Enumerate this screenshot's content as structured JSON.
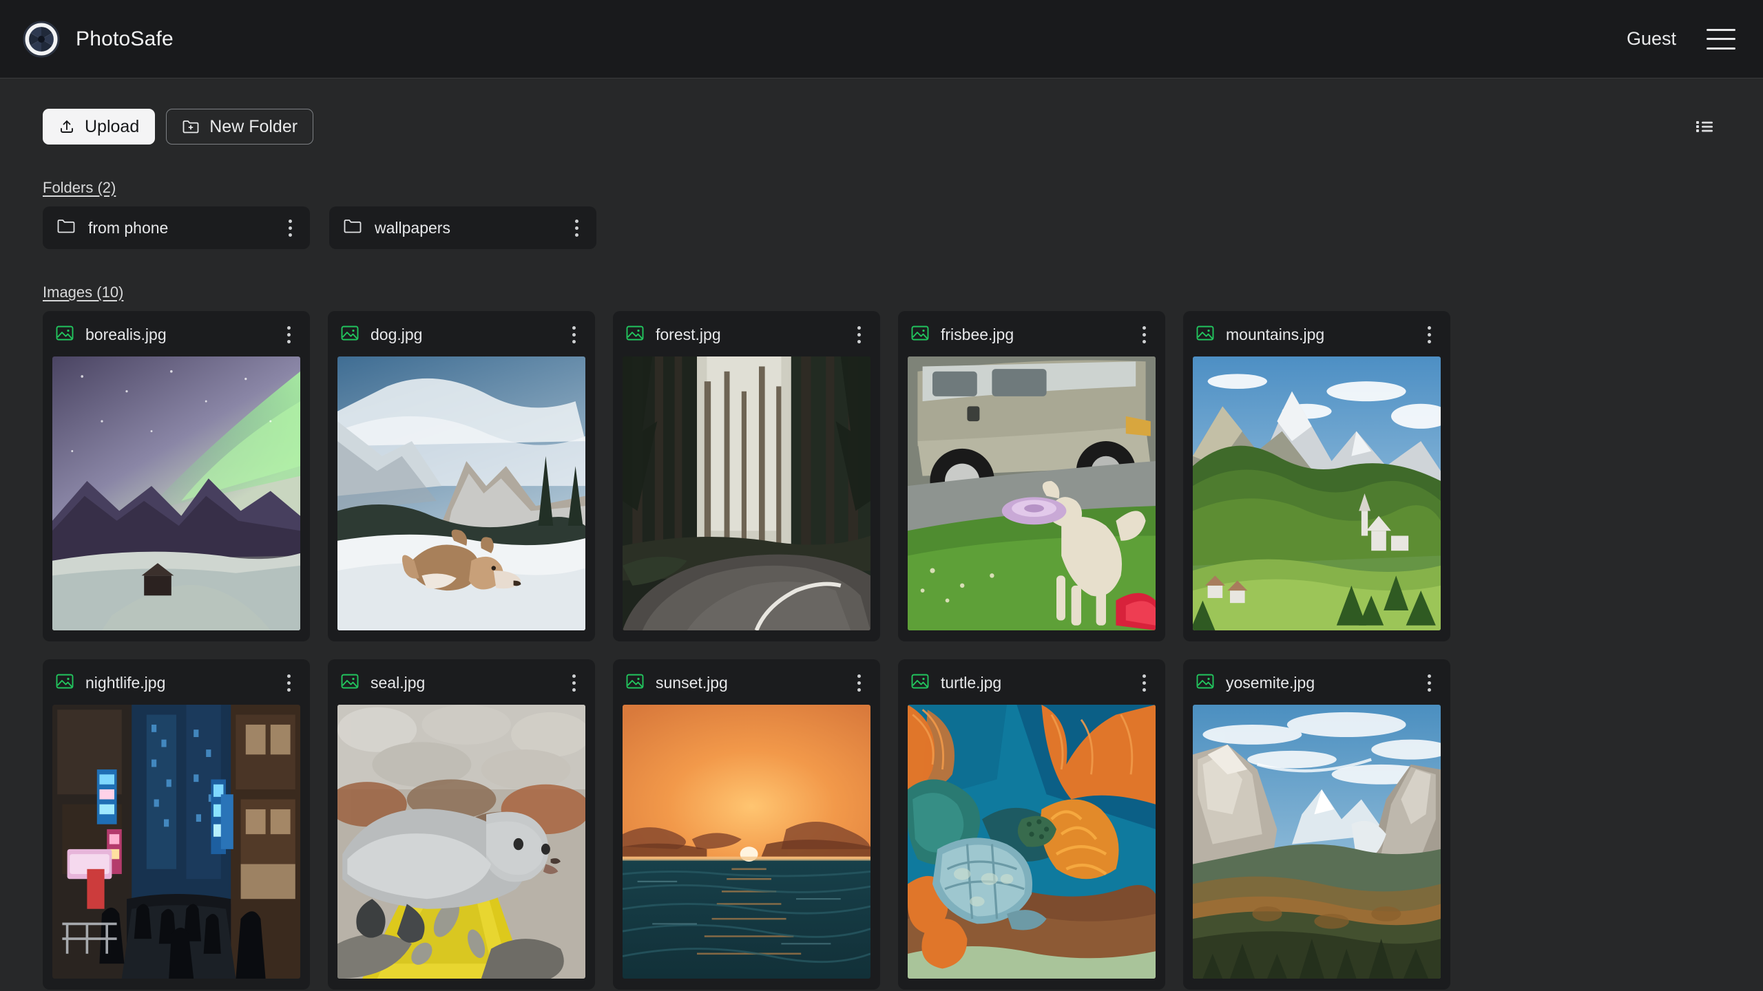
{
  "app": {
    "brand_name": "PhotoSafe",
    "logo_icon": "aperture-icon",
    "accent_green": "#22c55e",
    "page_bg": "#272829",
    "header_bg": "#191a1c",
    "card_bg": "#1b1c1e"
  },
  "header": {
    "user_label": "Guest",
    "menu_icon": "hamburger-icon"
  },
  "toolbar": {
    "upload_label": "Upload",
    "upload_icon": "upload-arrow-icon",
    "new_folder_label": "New Folder",
    "new_folder_icon": "folder-plus-icon",
    "view_toggle_icon": "list-view-icon"
  },
  "sections": {
    "folders_title": "Folders (2)",
    "images_title": "Images (10)"
  },
  "folders": [
    {
      "name": "from phone",
      "icon": "folder-icon",
      "menu_icon": "kebab-icon"
    },
    {
      "name": "wallpapers",
      "icon": "folder-icon",
      "menu_icon": "kebab-icon"
    }
  ],
  "images": [
    {
      "name": "borealis.jpg",
      "icon": "image-icon",
      "menu_icon": "kebab-icon",
      "thumb": "aurora"
    },
    {
      "name": "dog.jpg",
      "icon": "image-icon",
      "menu_icon": "kebab-icon",
      "thumb": "husky"
    },
    {
      "name": "forest.jpg",
      "icon": "image-icon",
      "menu_icon": "kebab-icon",
      "thumb": "forest"
    },
    {
      "name": "frisbee.jpg",
      "icon": "image-icon",
      "menu_icon": "kebab-icon",
      "thumb": "frisbee"
    },
    {
      "name": "mountains.jpg",
      "icon": "image-icon",
      "menu_icon": "kebab-icon",
      "thumb": "alps"
    },
    {
      "name": "nightlife.jpg",
      "icon": "image-icon",
      "menu_icon": "kebab-icon",
      "thumb": "city"
    },
    {
      "name": "seal.jpg",
      "icon": "image-icon",
      "menu_icon": "kebab-icon",
      "thumb": "seal"
    },
    {
      "name": "sunset.jpg",
      "icon": "image-icon",
      "menu_icon": "kebab-icon",
      "thumb": "sunset"
    },
    {
      "name": "turtle.jpg",
      "icon": "image-icon",
      "menu_icon": "kebab-icon",
      "thumb": "turtle"
    },
    {
      "name": "yosemite.jpg",
      "icon": "image-icon",
      "menu_icon": "kebab-icon",
      "thumb": "yosemite"
    }
  ]
}
